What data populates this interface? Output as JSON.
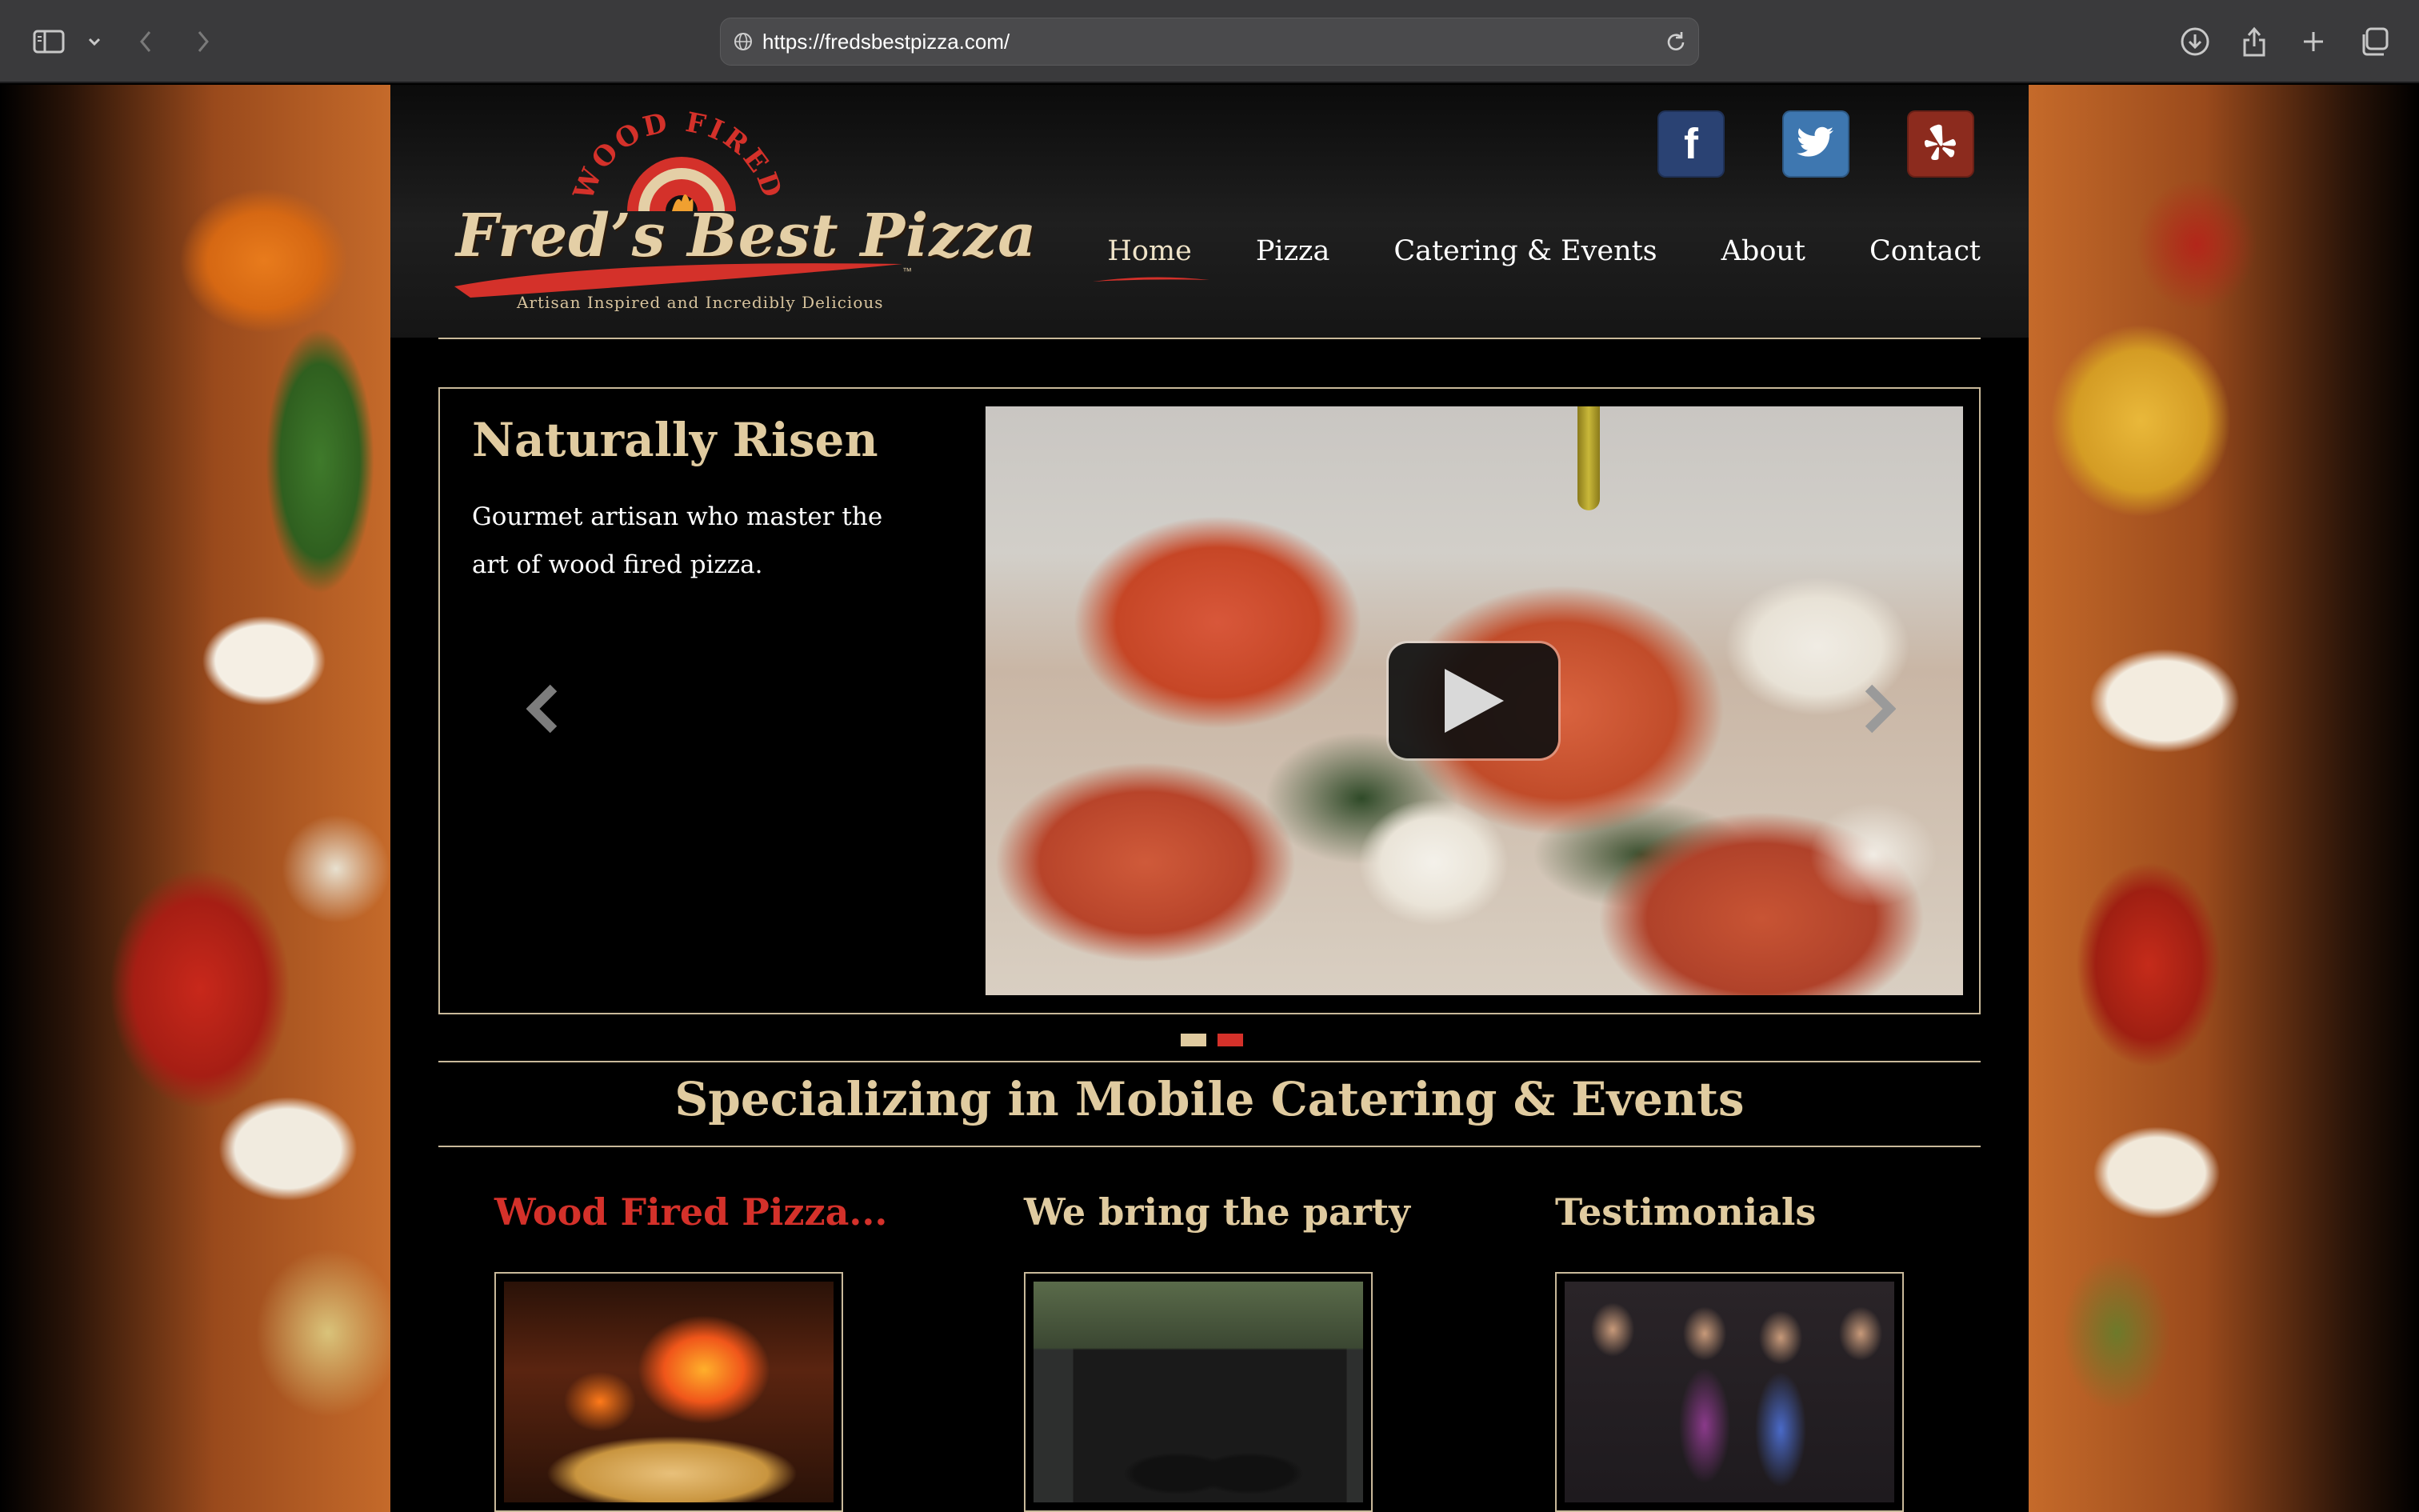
{
  "browser": {
    "url": "https://fredsbestpizza.com/"
  },
  "logo": {
    "arc_text": "WOOD FIRED",
    "brand": "Fred’s Best Pizza",
    "tm": "™",
    "tagline": "Artisan Inspired and Incredibly Delicious"
  },
  "social": {
    "facebook": "f",
    "twitter_icon": "twitter-bird-icon",
    "yelp_icon": "yelp-icon"
  },
  "nav": {
    "items": [
      "Home",
      "Pizza",
      "Catering & Events",
      "About",
      "Contact"
    ],
    "active": "Home"
  },
  "slider": {
    "title": "Naturally Risen",
    "text": "Gourmet artisan who master the art of wood fired pizza.",
    "slide_count": 2
  },
  "section": {
    "title": "Specializing in Mobile Catering & Events"
  },
  "columns": [
    {
      "title": "Wood Fired Pizza..."
    },
    {
      "title": "We bring the party"
    },
    {
      "title": "Testimonials"
    }
  ],
  "colors": {
    "accent_red": "#d4312a",
    "gold": "#e0cba0",
    "facebook": "#2a4273",
    "twitter": "#3e77b0",
    "yelp": "#8c2b1e"
  }
}
